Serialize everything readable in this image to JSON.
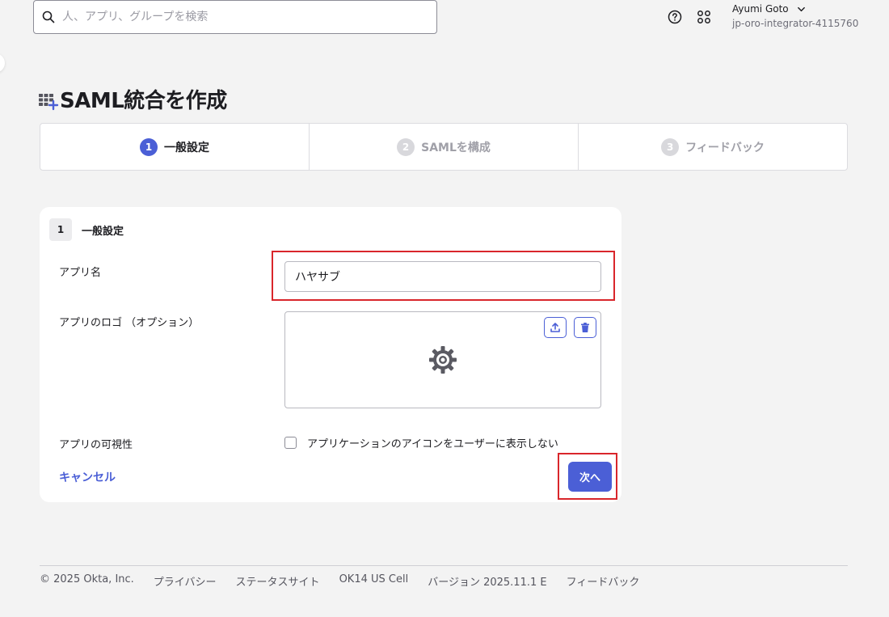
{
  "search": {
    "placeholder": "人、アプリ、グループを検索"
  },
  "header": {
    "user_name": "Ayumi Goto",
    "org_name": "jp-oro-integrator-4115760",
    "icons": [
      "help-icon",
      "apps-grid-icon",
      "chevron-down-icon"
    ]
  },
  "page": {
    "title": "SAML統合を作成"
  },
  "stepper": {
    "steps": [
      {
        "num": "1",
        "label": "一般設定",
        "active": true
      },
      {
        "num": "2",
        "label": "SAMLを構成",
        "active": false
      },
      {
        "num": "3",
        "label": "フィードバック",
        "active": false
      }
    ]
  },
  "form": {
    "section_num": "1",
    "section_title": "一般設定",
    "app_name_label": "アプリ名",
    "app_name_value": "ハヤサブ",
    "logo_label": "アプリのロゴ （オプション）",
    "visibility_label": "アプリの可視性",
    "visibility_checkbox_label": "アプリケーションのアイコンをユーザーに表示しない",
    "visibility_checked": false,
    "cancel_label": "キャンセル",
    "next_label": "次へ"
  },
  "footer": {
    "copyright": "© 2025 Okta, Inc.",
    "privacy": "プライバシー",
    "status_site": "ステータスサイト",
    "cell": "OK14 US Cell",
    "version": "バージョン 2025.11.1 E",
    "feedback": "フィードバック"
  },
  "colors": {
    "accent": "#4b5fd6",
    "highlight": "#d9262b",
    "background": "#f3f3f3"
  }
}
